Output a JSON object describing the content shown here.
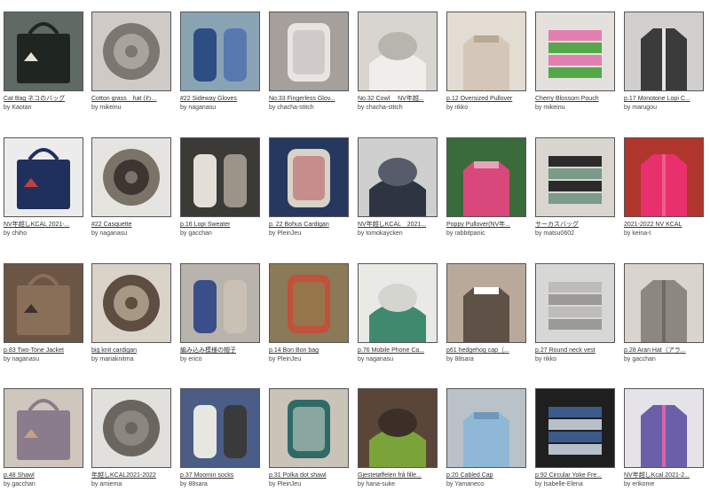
{
  "by_prefix": "by",
  "projects": [
    {
      "title": "Cat Bag ネコのバッグ",
      "author": "Kaotan",
      "icon": "cat-bag-icon",
      "bg": "#5e6a63",
      "fg": "#1f2622",
      "accent": "#e8e2d6"
    },
    {
      "title": "Cotton grass　hat (わ...",
      "author": "mikeinu",
      "icon": "cotton-grass-hat-icon",
      "bg": "#cfcac6",
      "fg": "#7d7772",
      "accent": "#a9a39e"
    },
    {
      "title": "#22 Sideway Gloves",
      "author": "naganasu",
      "icon": "gloves-icon",
      "bg": "#8aa3b4",
      "fg": "#2d4d84",
      "accent": "#5878b0"
    },
    {
      "title": "No.33 Fingerless Glov...",
      "author": "chacha-stitch",
      "icon": "fingerless-gloves-icon",
      "bg": "#a5a09c",
      "fg": "#e7e4e2",
      "accent": "#b9b2ae"
    },
    {
      "title": "No.32 Cowl 　NV年越...",
      "author": "chacha-stitch",
      "icon": "cowl-icon",
      "bg": "#d8d5d1",
      "fg": "#f0eeea",
      "accent": "#b8b4ae"
    },
    {
      "title": "p.12 Oversized Pullover",
      "author": "rikko",
      "icon": "pullover-icon",
      "bg": "#e3dcd3",
      "fg": "#d4c7b9",
      "accent": "#b9a894"
    },
    {
      "title": "Cherry Blossom Pouch",
      "author": "mikeinu",
      "icon": "pouch-icon",
      "bg": "#e4e0dd",
      "fg": "#55a74a",
      "accent": "#e37fae"
    },
    {
      "title": "p.17 Monotone Lopi C...",
      "author": "marugou",
      "icon": "lopi-cardigan-icon",
      "bg": "#d2d0ce",
      "fg": "#3b3b3b",
      "accent": "#e8e6e3"
    },
    {
      "title": "NV年越しKCAL 2021-...",
      "author": "chiho",
      "icon": "striped-sweater-icon",
      "bg": "#ececec",
      "fg": "#20305c",
      "accent": "#c53f42"
    },
    {
      "title": "#22 Casquette",
      "author": "naganasu",
      "icon": "casquette-icon",
      "bg": "#e6e4e1",
      "fg": "#7b7368",
      "accent": "#3d3530"
    },
    {
      "title": "p.16 Lopi Sweater",
      "author": "gacchan",
      "icon": "lopi-sweater-icon",
      "bg": "#3b3a37",
      "fg": "#e4dfd6",
      "accent": "#9b9489"
    },
    {
      "title": "p. 22 Bohus Cardigan",
      "author": "PleinJeu",
      "icon": "bohus-cardigan-icon",
      "bg": "#26385e",
      "fg": "#d7d3c8",
      "accent": "#b8474d"
    },
    {
      "title": "NV年越しKCAL　2021...",
      "author": "tomokaycken",
      "icon": "vest-icon",
      "bg": "#cfcfcf",
      "fg": "#2e3442",
      "accent": "#555c6a"
    },
    {
      "title": "Poppy Pullover(NV年...",
      "author": "rabbitpanic",
      "icon": "poppy-pullover-icon",
      "bg": "#3a6b3d",
      "fg": "#d9487a",
      "accent": "#e6a3bb"
    },
    {
      "title": "サーカスバッグ",
      "author": "matsu0602",
      "icon": "circus-bag-icon",
      "bg": "#d9d6cf",
      "fg": "#7a9a8a",
      "accent": "#2b2b2b"
    },
    {
      "title": "2021-2022 NV KCAL",
      "author": "keina-t",
      "icon": "pink-top-icon",
      "bg": "#b0352c",
      "fg": "#e8316c",
      "accent": "#f05c8a"
    },
    {
      "title": "p.83 Two-Tone Jacket",
      "author": "naganasu",
      "icon": "jacket-icon",
      "bg": "#6b5646",
      "fg": "#8a6f58",
      "accent": "#3e3129"
    },
    {
      "title": "big knit cardigan",
      "author": "mariaknitma",
      "icon": "big-cardigan-icon",
      "bg": "#d9d3c8",
      "fg": "#5e4d41",
      "accent": "#a79886"
    },
    {
      "title": "編み込み模様の帽子",
      "author": "erico",
      "icon": "fair-isle-hat-icon",
      "bg": "#b9b3ad",
      "fg": "#3a4f8a",
      "accent": "#c9c1b4"
    },
    {
      "title": "p.14 Bon Bon bag",
      "author": "PleinJeu",
      "icon": "bonbon-bag-icon",
      "bg": "#8a7a58",
      "fg": "#c0513a",
      "accent": "#6e9a5c"
    },
    {
      "title": "p.76 Mobile Phone Ca...",
      "author": "naganasu",
      "icon": "phone-case-icon",
      "bg": "#e9e9e6",
      "fg": "#3f8a6f",
      "accent": "#d5d5d0"
    },
    {
      "title": "p61 hedgehog cap（...",
      "author": "88sara",
      "icon": "hedgehog-cap-icon",
      "bg": "#b8a99a",
      "fg": "#5e5246",
      "accent": "#ffffff"
    },
    {
      "title": "p.27 Round neck vest",
      "author": "rikko",
      "icon": "round-neck-vest-icon",
      "bg": "#d7d7d5",
      "fg": "#9c9a98",
      "accent": "#bebcb9"
    },
    {
      "title": "p.28 Aran Hat（アラ...",
      "author": "gacchan",
      "icon": "aran-hat-icon",
      "bg": "#d9d4cd",
      "fg": "#8c8880",
      "accent": "#6f6b64"
    },
    {
      "title": "p.48 Shawl",
      "author": "gacchan",
      "icon": "shawl-icon",
      "bg": "#cfc6bd",
      "fg": "#8a7c8c",
      "accent": "#c7a27a"
    },
    {
      "title": "年越しKCAL2021-2022",
      "author": "amiema",
      "icon": "shorts-icon",
      "bg": "#e2e0dc",
      "fg": "#6a665f",
      "accent": "#8b877f"
    },
    {
      "title": "p.37 Moomin socks",
      "author": "88sara",
      "icon": "moomin-socks-icon",
      "bg": "#4a5d86",
      "fg": "#e8e6e1",
      "accent": "#3a3a3a"
    },
    {
      "title": "p.31 Polka dot shawl",
      "author": "PleinJeu",
      "icon": "polka-dot-shawl-icon",
      "bg": "#c9c3b8",
      "fg": "#2f6a66",
      "accent": "#e6e2da"
    },
    {
      "title": "Gjestetøffelen frå fille...",
      "author": "hana-suke",
      "icon": "slippers-icon",
      "bg": "#5a4638",
      "fg": "#7aa43a",
      "accent": "#3c2f27"
    },
    {
      "title": "p.20 Cabled Cap",
      "author": "Yamaneco",
      "icon": "cabled-cap-icon",
      "bg": "#b9c2c8",
      "fg": "#8fb7d6",
      "accent": "#6f98b8"
    },
    {
      "title": "p.92 Circular Yoke Fre...",
      "author": "Isabelle-Elena",
      "icon": "circular-yoke-icon",
      "bg": "#1f1f1f",
      "fg": "#b7c0c8",
      "accent": "#3c5a8a"
    },
    {
      "title": "NV年越しKcal 2021-2...",
      "author": "erikome",
      "icon": "gradient-cowl-icon",
      "bg": "#e5e2e8",
      "fg": "#6a5fa8",
      "accent": "#d765a8"
    }
  ]
}
